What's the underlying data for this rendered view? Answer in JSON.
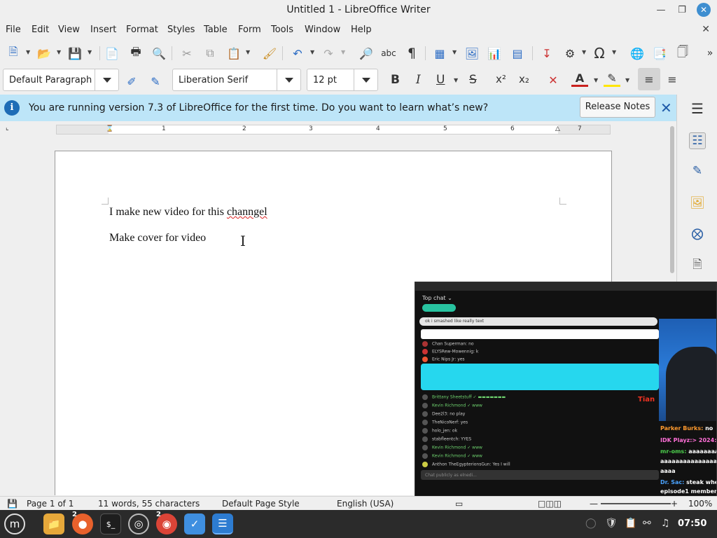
{
  "window": {
    "title": "Untitled 1 - LibreOffice Writer",
    "minimize_icon": "minimize-icon",
    "restore_icon": "restore-icon",
    "close_icon": "close-icon"
  },
  "menubar": {
    "items": [
      "File",
      "Edit",
      "View",
      "Insert",
      "Format",
      "Styles",
      "Table",
      "Form",
      "Tools",
      "Window",
      "Help"
    ]
  },
  "toolbar_formatting": {
    "paragraph_style": "Default Paragraph",
    "font_name": "Liberation Serif",
    "font_size": "12 pt",
    "bold": "B",
    "italic": "I",
    "underline": "U",
    "strike": "S",
    "superscript": "x²",
    "subscript": "x₂"
  },
  "infobar": {
    "message": "You are running version 7.3 of LibreOffice for the first time. Do you want to learn what’s new?",
    "button_label": "Release Notes",
    "accent": "#bde5f8"
  },
  "ruler": {
    "numbers": [
      "1",
      "1",
      "2",
      "3",
      "4",
      "5",
      "6",
      "7"
    ]
  },
  "document": {
    "line1_prefix": "I make new video for this ",
    "line1_misspelled": "channgel",
    "line2": "Make cover for video"
  },
  "overlay": {
    "chat_title": "Top chat ⌄",
    "pinned_text": "ok i smashed like really text",
    "red_text": "Tian",
    "side_chat": [
      {
        "name": "Parker Burks:",
        "text": " no",
        "color": "#ff9a2e"
      },
      {
        "name": "IDK Playz:> 2024:",
        "text": " h",
        "color": "#ff6fd8"
      },
      {
        "name": "mr-oms:",
        "text": " aaaaaaaAaa",
        "color": "#4dd14d"
      },
      {
        "name": "",
        "text": "aaaaaaaaaaaaaaaa",
        "color": "#ffffff"
      },
      {
        "name": "",
        "text": "aaaa",
        "color": "#ffffff"
      },
      {
        "name": "Dr. Sac:",
        "text": " steak when",
        "color": "#4aa3ff"
      },
      {
        "name": "",
        "text": "episode1 member",
        "color": "#ffffff"
      }
    ],
    "chat_rows": [
      "Chan Superman: no",
      "ELYSRew-Mowennig: k",
      "Eric Nips Jr: yes",
      "Brittany Sheetstuff ✓ ▬▬▬▬▬▬▬",
      "Kevin Richmond ✓ www",
      "Dee2l3: no play",
      "TheNicoNerf: yes",
      "holo_jen: ok",
      "stabfleentch: YYES",
      "Kevin Richmond ✓ www",
      "Kevin Richmond ✓ www",
      "Anthon TheEgypterionsGun: Yes I will"
    ],
    "input_placeholder": "Chat publicly as elnedi..."
  },
  "statusbar": {
    "page": "Page 1 of 1",
    "words": "11 words, 55 characters",
    "page_style": "Default Page Style",
    "language": "English (USA)",
    "zoom": "100%"
  },
  "taskbar": {
    "badge_firefox": "2",
    "badge_chrome": "2",
    "clock": "07:50"
  }
}
